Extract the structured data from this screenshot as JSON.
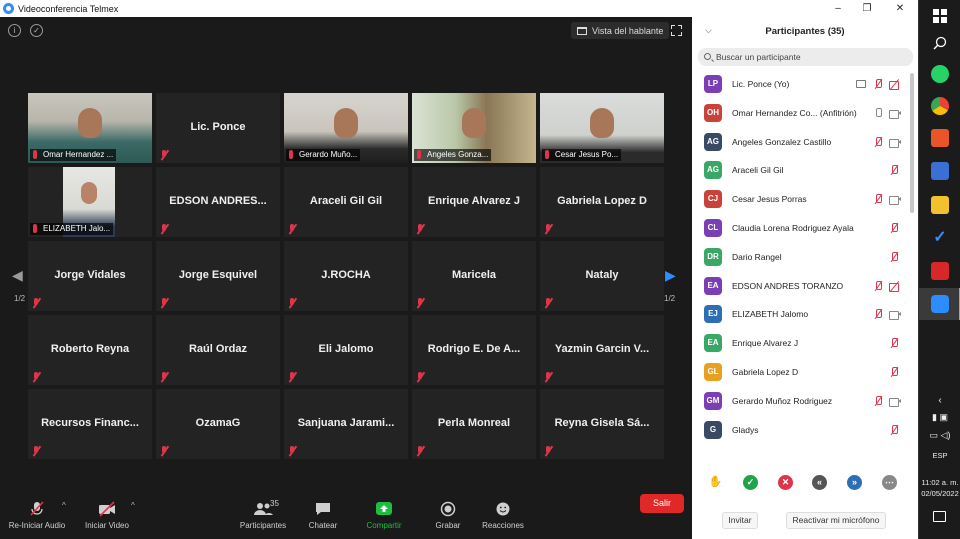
{
  "window": {
    "title": "Videoconferencia Telmex",
    "minimize": "–",
    "maximize": "❐",
    "close": "✕"
  },
  "meeting": {
    "info_icon": "i",
    "shield_icon": "✓",
    "view_button": "Vista del hablante",
    "page_indicator": "1/2",
    "tiles": [
      {
        "name": "Omar Hernandez ...",
        "type": "video",
        "caption": true,
        "highlighted": true
      },
      {
        "name": "Lic. Ponce",
        "type": "text"
      },
      {
        "name": "Gerardo Muño...",
        "type": "video",
        "caption": true
      },
      {
        "name": "Angeles Gonza...",
        "type": "video",
        "caption": true
      },
      {
        "name": "Cesar Jesus Po...",
        "type": "video",
        "caption": true
      },
      {
        "name": "ELIZABETH Jalo...",
        "type": "video",
        "caption": true
      },
      {
        "name": "EDSON  ANDRES...",
        "type": "text"
      },
      {
        "name": "Araceli Gil Gil",
        "type": "text"
      },
      {
        "name": "Enrique Alvarez J",
        "type": "text"
      },
      {
        "name": "Gabriela Lopez D",
        "type": "text"
      },
      {
        "name": "Jorge Vidales",
        "type": "text"
      },
      {
        "name": "Jorge Esquivel",
        "type": "text"
      },
      {
        "name": "J.ROCHA",
        "type": "text"
      },
      {
        "name": "Maricela",
        "type": "text"
      },
      {
        "name": "Nataly",
        "type": "text"
      },
      {
        "name": "Roberto Reyna",
        "type": "text"
      },
      {
        "name": "Raúl Ordaz",
        "type": "text"
      },
      {
        "name": "Eli Jalomo",
        "type": "text"
      },
      {
        "name": "Rodrigo E. De A...",
        "type": "text"
      },
      {
        "name": "Yazmin Garcin V...",
        "type": "text"
      },
      {
        "name": "Recursos  Financ...",
        "type": "text"
      },
      {
        "name": "OzamaG",
        "type": "text"
      },
      {
        "name": "Sanjuana  Jarami...",
        "type": "text"
      },
      {
        "name": "Perla Monreal",
        "type": "text"
      },
      {
        "name": "Reyna Gisela Sá...",
        "type": "text"
      }
    ]
  },
  "toolbar": {
    "audio": "Re-Iniciar Audio",
    "video": "Iniciar Video",
    "participants": "Participantes",
    "participants_count": "35",
    "chat": "Chatear",
    "share": "Compartir",
    "record": "Grabar",
    "reactions": "Reacciones",
    "end": "Salir"
  },
  "panel": {
    "title": "Participantes (35)",
    "search_placeholder": "Buscar un participante",
    "invite": "Invitar",
    "unmute": "Reactivar mi micrófono",
    "participants": [
      {
        "initials": "LP",
        "name": "Lic. Ponce (Yo)",
        "color": "#7b3fb5",
        "mic": "muted",
        "video": "off",
        "share": true
      },
      {
        "initials": "OH",
        "name": "Omar Hernandez Co...  (Anfitrión)",
        "color": "#c8433a",
        "mic": "on",
        "video": "on"
      },
      {
        "initials": "AG",
        "name": "Angeles Gonzalez Castillo",
        "color": "#3b4a63",
        "mic": "muted",
        "video": "on"
      },
      {
        "initials": "AG",
        "name": "Araceli Gil Gil",
        "color": "#3aa767",
        "mic": "muted",
        "video": "none"
      },
      {
        "initials": "CJ",
        "name": "Cesar Jesus Porras",
        "color": "#c8433a",
        "mic": "muted",
        "video": "on"
      },
      {
        "initials": "CL",
        "name": "Claudia Lorena Rodriguez Ayala",
        "color": "#7b3fb5",
        "mic": "muted",
        "video": "none"
      },
      {
        "initials": "DR",
        "name": "Dario Rangel",
        "color": "#3aa767",
        "mic": "muted",
        "video": "none"
      },
      {
        "initials": "EA",
        "name": "EDSON ANDRES TORANZO",
        "color": "#7b3fb5",
        "mic": "muted",
        "video": "off"
      },
      {
        "initials": "EJ",
        "name": "ELIZABETH Jalomo",
        "color": "#2d6fb5",
        "mic": "muted",
        "video": "on"
      },
      {
        "initials": "EA",
        "name": "Enrique Alvarez J",
        "color": "#3aa767",
        "mic": "muted",
        "video": "none"
      },
      {
        "initials": "GL",
        "name": "Gabriela Lopez D",
        "color": "#e8a020",
        "mic": "muted",
        "video": "none"
      },
      {
        "initials": "GM",
        "name": "Gerardo Muñoz Rodriguez",
        "color": "#7b3fb5",
        "mic": "muted",
        "video": "on"
      },
      {
        "initials": "G",
        "name": "Gladys",
        "color": "#3b4a63",
        "mic": "muted",
        "video": "none"
      }
    ]
  },
  "taskbar": {
    "time": "11:02 a. m.",
    "date": "02/05/2022",
    "lang": "ESP"
  },
  "colors": {
    "accent": "#2d8cff",
    "muted": "#e0344b",
    "end": "#e02828",
    "share": "#1dbf3e"
  }
}
